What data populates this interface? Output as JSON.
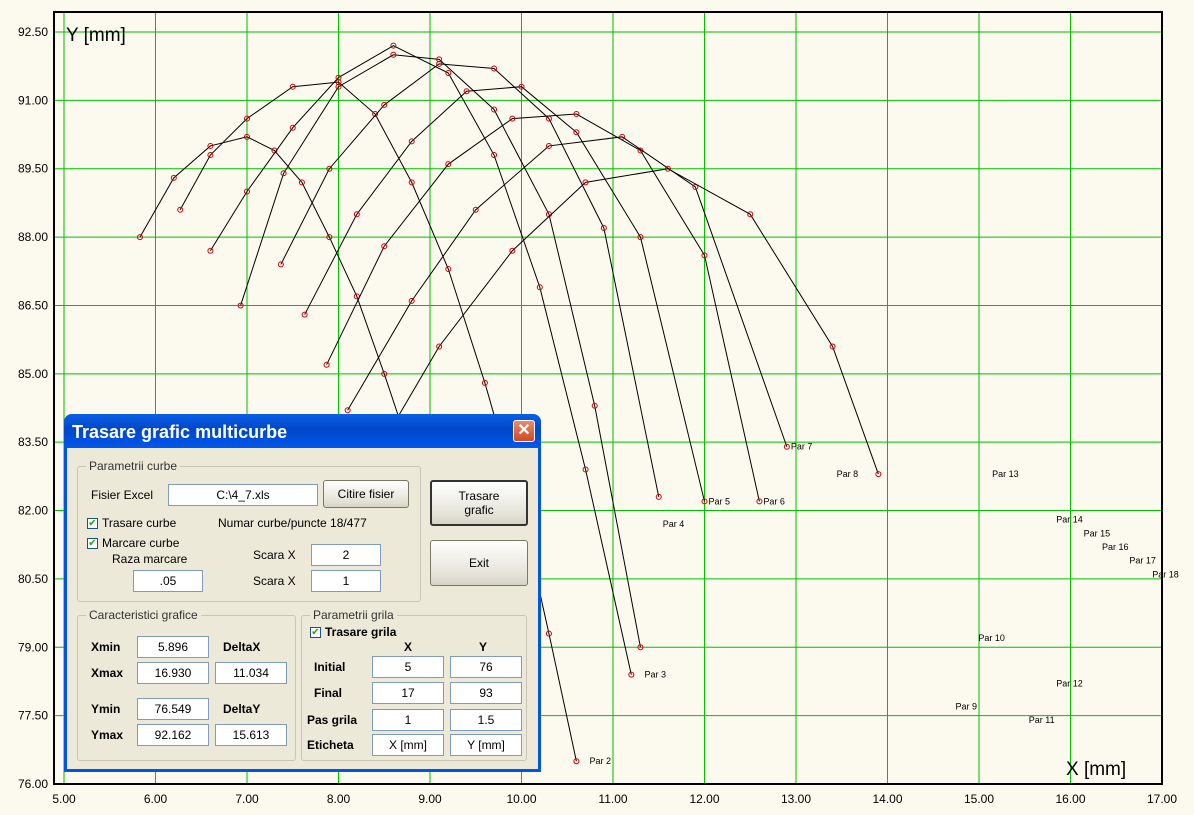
{
  "plot": {
    "y_title": "Y [mm]",
    "x_title": "X [mm]",
    "x_ticks": [
      "5.00",
      "6.00",
      "7.00",
      "8.00",
      "9.00",
      "10.00",
      "11.00",
      "12.00",
      "13.00",
      "14.00",
      "15.00",
      "16.00",
      "17.00"
    ],
    "y_ticks": [
      "92.50",
      "91.00",
      "89.50",
      "88.00",
      "86.50",
      "85.00",
      "83.50",
      "82.00",
      "80.50",
      "79.00",
      "77.50",
      "76.00"
    ],
    "grid_color": "#00C000",
    "curve_color": "#000000",
    "marker_color": "#D00000",
    "background": "#FCF9EE",
    "curve_labels": [
      "Par 2",
      "Par 3",
      "Par 4",
      "Par 5",
      "Par 6",
      "Par 7",
      "Par 8",
      "Par 9",
      "Par 10",
      "Par 11",
      "Par 12",
      "Par 13",
      "Par 14",
      "Par 15",
      "Par 16",
      "Par 17",
      "Par 18"
    ]
  },
  "chart_data": {
    "type": "line",
    "xlabel": "X [mm]",
    "ylabel": "Y [mm]",
    "xlim": [
      5,
      17
    ],
    "ylim": [
      76,
      93
    ],
    "grid": true,
    "series": [
      {
        "name": "",
        "x": [
          5.83,
          6.2,
          6.6,
          7.0,
          7.3,
          7.6,
          7.9,
          8.2,
          8.5,
          8.8,
          9.0
        ],
        "y": [
          88.0,
          89.3,
          90.0,
          90.2,
          89.9,
          89.2,
          88.0,
          86.7,
          85.0,
          83.2,
          81.5
        ]
      },
      {
        "name": "",
        "x": [
          6.27,
          6.6,
          7.0,
          7.5,
          8.0,
          8.4,
          8.8,
          9.2,
          9.6,
          10.0,
          10.3,
          10.6
        ],
        "y": [
          88.6,
          89.8,
          90.6,
          91.3,
          91.4,
          90.7,
          89.2,
          87.3,
          84.8,
          82.0,
          79.3,
          76.5
        ]
      },
      {
        "name": "",
        "x": [
          6.6,
          7.0,
          7.5,
          8.0,
          8.6,
          9.2,
          9.7,
          10.2,
          10.7,
          11.2
        ],
        "y": [
          87.7,
          89.0,
          90.4,
          91.5,
          92.2,
          91.6,
          89.8,
          86.9,
          82.9,
          78.4
        ]
      },
      {
        "name": "",
        "x": [
          6.93,
          7.4,
          8.0,
          8.6,
          9.1,
          9.7,
          10.3,
          10.8,
          11.3
        ],
        "y": [
          86.5,
          89.4,
          91.3,
          92.0,
          91.9,
          90.8,
          88.5,
          84.3,
          79.0
        ]
      },
      {
        "name": "",
        "x": [
          7.37,
          7.9,
          8.5,
          9.1,
          9.7,
          10.3,
          10.9,
          11.5
        ],
        "y": [
          87.4,
          89.5,
          90.9,
          91.8,
          91.7,
          90.6,
          88.2,
          82.3
        ]
      },
      {
        "name": "",
        "x": [
          7.63,
          8.2,
          8.8,
          9.4,
          10.0,
          10.6,
          11.3,
          12.0
        ],
        "y": [
          86.3,
          88.5,
          90.1,
          91.2,
          91.3,
          90.3,
          88.0,
          82.2
        ]
      },
      {
        "name": "",
        "x": [
          7.87,
          8.5,
          9.2,
          9.9,
          10.6,
          11.3,
          12.0,
          12.6
        ],
        "y": [
          85.2,
          87.8,
          89.6,
          90.6,
          90.7,
          89.9,
          87.6,
          82.2
        ]
      },
      {
        "name": "",
        "x": [
          8.1,
          8.8,
          9.5,
          10.3,
          11.1,
          11.9,
          12.9
        ],
        "y": [
          84.2,
          86.6,
          88.6,
          90.0,
          90.2,
          89.1,
          83.4
        ]
      },
      {
        "name": "",
        "x": [
          8.4,
          9.1,
          9.9,
          10.7,
          11.6,
          12.5,
          13.4,
          13.9
        ],
        "y": [
          83.2,
          85.6,
          87.7,
          89.2,
          89.5,
          88.5,
          85.6,
          82.8
        ]
      }
    ]
  },
  "dialog": {
    "title": "Trasare grafic multicurbe",
    "close_glyph": "✕",
    "params_group": "Parametrii curbe",
    "fisier_label": "Fisier Excel",
    "fisier_value": "C:\\4_7.xls",
    "citire_button": "Citire fisier",
    "trasare_curbe": "Trasare curbe",
    "numar_label": "Numar curbe/puncte 18/477",
    "marcare_curbe": "Marcare curbe",
    "raza_label": "Raza marcare",
    "raza_value": ".05",
    "scara_x_label_1": "Scara X",
    "scara_x_value_1": "2",
    "scara_x_label_2": "Scara X",
    "scara_x_value_2": "1",
    "trasare_button": "Trasare grafic",
    "exit_button": "Exit",
    "check_glyph": "✔",
    "caract_group": "Caracteristici grafice",
    "xmin_label": "Xmin",
    "xmin_value": "5.896",
    "deltax_label": "DeltaX",
    "xmax_label": "Xmax",
    "xmax_value": "16.930",
    "deltax_value": "11.034",
    "ymin_label": "Ymin",
    "ymin_value": "76.549",
    "deltay_label": "DeltaY",
    "ymax_label": "Ymax",
    "ymax_value": "92.162",
    "deltay_value": "15.613",
    "grila_group": "Parametrii grila",
    "trasare_grila": "Trasare grila",
    "col_x": "X",
    "col_y": "Y",
    "initial_label": "Initial",
    "initial_x": "5",
    "initial_y": "76",
    "final_label": "Final",
    "final_x": "17",
    "final_y": "93",
    "pas_label": "Pas grila",
    "pas_x": "1",
    "pas_y": "1.5",
    "eticheta_label": "Eticheta",
    "eticheta_x": "X [mm]",
    "eticheta_y": "Y [mm]"
  }
}
